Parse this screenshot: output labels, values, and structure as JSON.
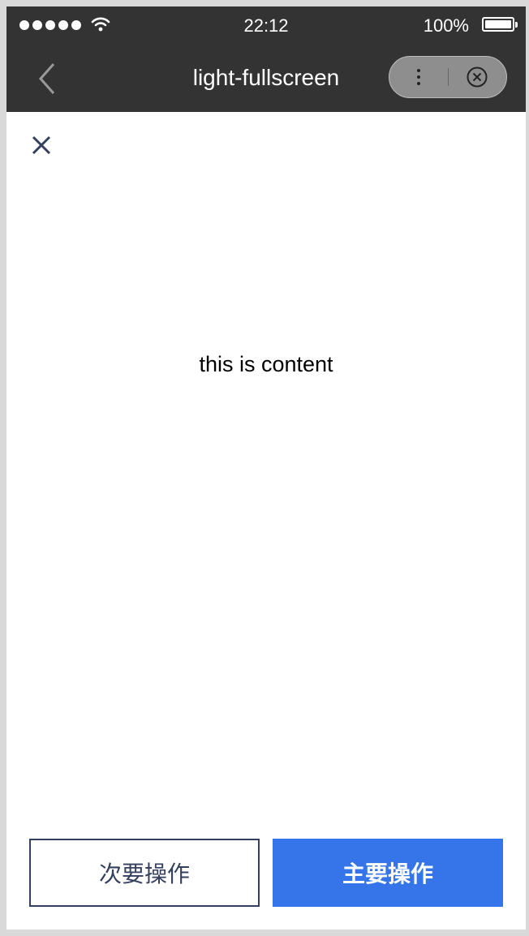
{
  "status_bar": {
    "time": "22:12",
    "battery_percent": "100%",
    "signal_icon": "signal-dots-icon",
    "wifi_icon": "wifi-icon",
    "battery_icon": "battery-icon"
  },
  "nav_bar": {
    "title": "light-fullscreen",
    "back_icon": "chevron-left-icon",
    "more_icon": "more-vertical-icon",
    "close_icon": "circle-close-icon",
    "background": "#333333"
  },
  "dialog": {
    "close_icon": "close-icon",
    "content_text": "this is content",
    "secondary_button": "次要操作",
    "primary_button": "主要操作"
  },
  "colors": {
    "primary": "#3575e9",
    "secondary_border": "#34405e",
    "nav_background": "#333333"
  }
}
